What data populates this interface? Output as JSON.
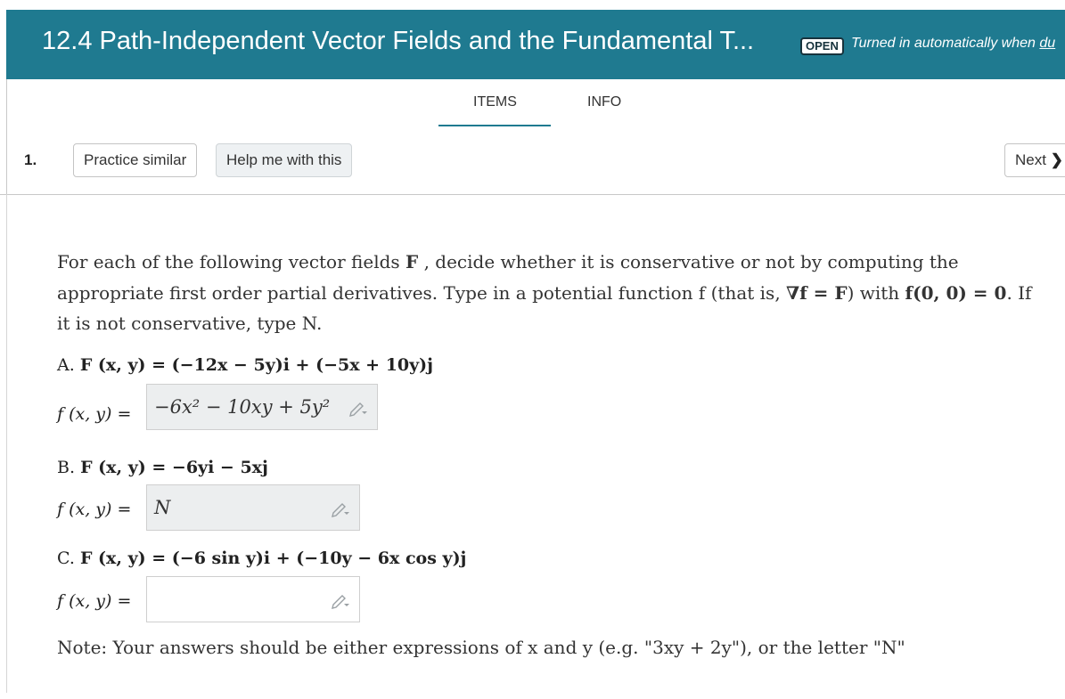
{
  "header": {
    "title": "12.4 Path-Independent Vector Fields and the Fundamental T...",
    "status_badge": "OPEN",
    "status_prefix": "Turned in automatically when ",
    "status_link": "du"
  },
  "tabs": [
    {
      "label": "ITEMS",
      "active": true
    },
    {
      "label": "INFO",
      "active": false
    }
  ],
  "toolbar": {
    "question_number": "1.",
    "practice_label": "Practice similar",
    "help_label": "Help me with this",
    "next_label": "Next",
    "next_icon": "chevron-right-icon"
  },
  "question": {
    "intro_1": "For each of the following vector fields ",
    "intro_F": "F",
    "intro_2": " , decide whether it is conservative or not by computing the appropriate first order partial derivatives. Type in a potential function f (that is, ",
    "intro_grad": "∇f = F",
    "intro_3": ") with ",
    "intro_cond": "f(0, 0) = 0",
    "intro_4": ". If it is not conservative, type N.",
    "parts": [
      {
        "letter": "A.",
        "field": "F (x, y) = (−12x − 5y)i + (−5x + 10y)j",
        "f_label": "f (x, y) =",
        "answer": "−6x² − 10xy + 5y²"
      },
      {
        "letter": "B.",
        "field": "F (x, y) = −6yi − 5xj",
        "f_label": "f (x, y) =",
        "answer": "N"
      },
      {
        "letter": "C.",
        "field": "F (x, y) = (−6 sin y)i + (−10y − 6x cos y)j",
        "f_label": "f (x, y) =",
        "answer": ""
      }
    ],
    "note": "Note: Your answers should be either expressions of x and y (e.g. \"3xy + 2y\"), or the letter \"N\""
  },
  "colors": {
    "header_bg": "#1f7a90",
    "tab_underline": "#1f7a90",
    "answer_filled_bg": "#eceeef"
  }
}
